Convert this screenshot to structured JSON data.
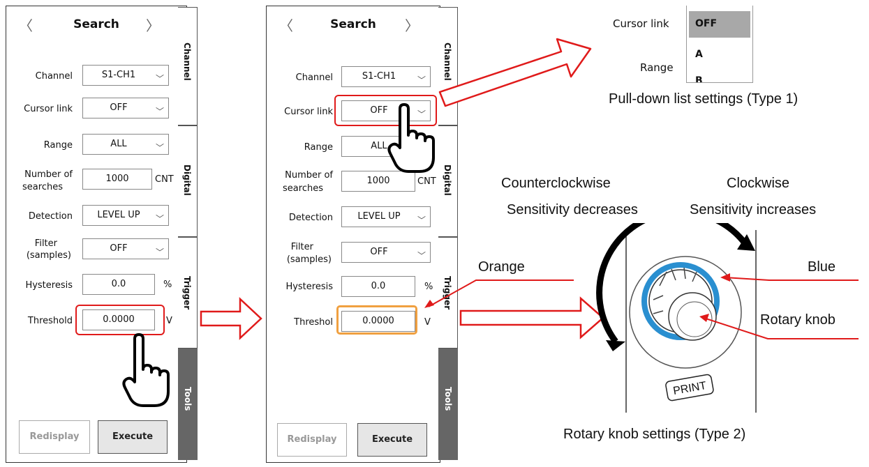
{
  "panel_left": {
    "title": "Search",
    "nav_prev": "〈",
    "nav_next": "〉",
    "rows": {
      "channel": {
        "label": "Channel",
        "value": "S1-CH1"
      },
      "cursor_link": {
        "label": "Cursor link",
        "value": "OFF"
      },
      "range": {
        "label": "Range",
        "value": "ALL"
      },
      "num_searches": {
        "label_1": "Number of",
        "label_2": "searches",
        "value": "1000",
        "unit": "CNT"
      },
      "detection": {
        "label": "Detection",
        "value": "LEVEL UP"
      },
      "filter": {
        "label_1": "Filter",
        "label_2": "(samples)",
        "value": "OFF"
      },
      "hysteresis": {
        "label": "Hysteresis",
        "value": "0.0",
        "unit": "%"
      },
      "threshold": {
        "label": "Threshold",
        "value": "0.0000",
        "unit": "V"
      }
    },
    "buttons": {
      "redisplay": "Redisplay",
      "execute": "Execute"
    },
    "tabs": [
      "Channel",
      "Digital",
      "Trigger",
      "Tools"
    ]
  },
  "panel_right": {
    "title": "Search",
    "nav_prev": "〈",
    "nav_next": "〉",
    "rows": {
      "channel": {
        "label": "Channel",
        "value": "S1-CH1"
      },
      "cursor_link": {
        "label": "Cursor link",
        "value": "OFF"
      },
      "range": {
        "label": "Range",
        "value": "ALL"
      },
      "num_searches": {
        "label_1": "Number of",
        "label_2": "searches",
        "value": "1000",
        "unit": "CNT"
      },
      "detection": {
        "label": "Detection",
        "value": "LEVEL UP"
      },
      "filter": {
        "label_1": "Filter",
        "label_2": "(samples)",
        "value": "OFF"
      },
      "hysteresis": {
        "label": "Hysteresis",
        "value": "0.0",
        "unit": "%"
      },
      "threshold": {
        "label": "Threshol",
        "value": "0.0000",
        "unit": "V"
      }
    },
    "buttons": {
      "redisplay": "Redisplay",
      "execute": "Execute"
    },
    "tabs": [
      "Channel",
      "Digital",
      "Trigger",
      "Tools"
    ]
  },
  "dropdown_popup": {
    "label_cursor_link": "Cursor link",
    "label_range": "Range",
    "options": [
      "OFF",
      "A",
      "B"
    ],
    "caption": "Pull-down list settings (Type 1)"
  },
  "rotary": {
    "ccw_line1": "Counterclockwise",
    "ccw_line2": "Sensitivity decreases",
    "cw_line1": "Clockwise",
    "cw_line2": "Sensitivity increases",
    "orange": "Orange",
    "blue": "Blue",
    "rotary_knob": "Rotary knob",
    "print_key": "PRINT",
    "caption": "Rotary knob settings (Type 2)"
  },
  "colors": {
    "red": "#e01a1a",
    "orange": "#f0a040",
    "blue": "#2a8fd0",
    "gray_tab": "#666666"
  }
}
